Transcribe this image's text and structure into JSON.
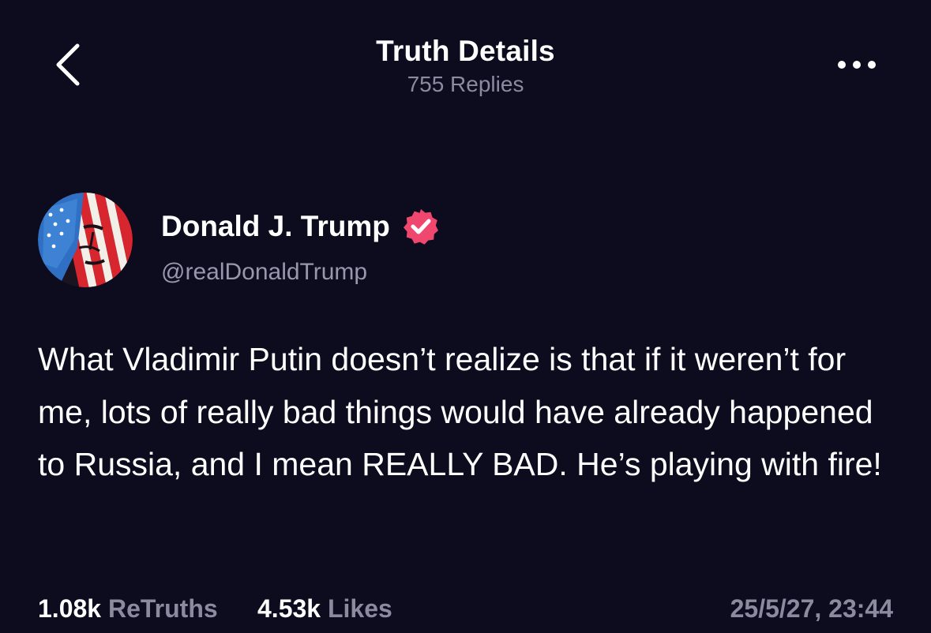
{
  "header": {
    "title": "Truth Details",
    "replies": "755 Replies"
  },
  "author": {
    "display_name": "Donald J. Trump",
    "handle": "@realDonaldTrump",
    "verified": true,
    "badge_color": "#f0476e"
  },
  "post": {
    "text": "What Vladimir Putin doesn’t realize is that if it weren’t for me, lots of really bad things would have already happened to Russia, and I mean REALLY BAD. He’s playing with fire!"
  },
  "stats": {
    "retruths_count": "1.08k",
    "retruths_label": "ReTruths",
    "likes_count": "4.53k",
    "likes_label": "Likes",
    "timestamp": "25/5/27, 23:44"
  },
  "icons": {
    "back": "chevron-left-icon",
    "more": "more-horizontal-icon",
    "verified": "verified-badge-icon"
  },
  "colors": {
    "background": "#0d0b1e",
    "muted_text": "#8d8aa0",
    "accent": "#f0476e"
  }
}
